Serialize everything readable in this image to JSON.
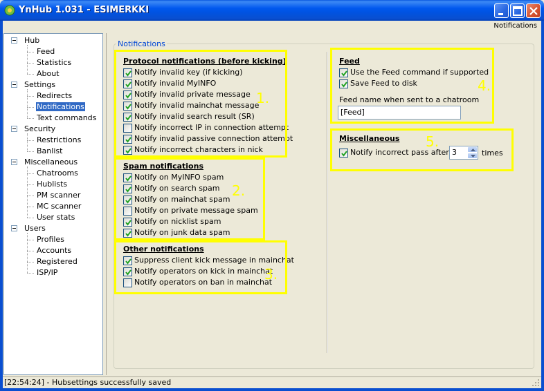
{
  "window": {
    "title": "YnHub 1.031 - ESIMERKKI",
    "page_label": "Notifications",
    "buttons": [
      "minimize",
      "maximize",
      "close"
    ]
  },
  "tree": {
    "items": [
      {
        "label": "Hub",
        "level": 0,
        "expander": true
      },
      {
        "label": "Feed",
        "level": 1
      },
      {
        "label": "Statistics",
        "level": 1
      },
      {
        "label": "About",
        "level": 1
      },
      {
        "label": "Settings",
        "level": 0,
        "expander": true
      },
      {
        "label": "Redirects",
        "level": 1
      },
      {
        "label": "Notifications",
        "level": 1,
        "selected": true
      },
      {
        "label": "Text commands",
        "level": 1
      },
      {
        "label": "Security",
        "level": 0,
        "expander": true
      },
      {
        "label": "Restrictions",
        "level": 1
      },
      {
        "label": "Banlist",
        "level": 1
      },
      {
        "label": "Miscellaneous",
        "level": 0,
        "expander": true
      },
      {
        "label": "Chatrooms",
        "level": 1
      },
      {
        "label": "Hublists",
        "level": 1
      },
      {
        "label": "PM scanner",
        "level": 1
      },
      {
        "label": "MC scanner",
        "level": 1
      },
      {
        "label": "User stats",
        "level": 1
      },
      {
        "label": "Users",
        "level": 0,
        "expander": true
      },
      {
        "label": "Profiles",
        "level": 1
      },
      {
        "label": "Accounts",
        "level": 1
      },
      {
        "label": "Registered",
        "level": 1
      },
      {
        "label": "ISP/IP",
        "level": 1
      }
    ]
  },
  "panel": {
    "legend": "Notifications",
    "protocol": {
      "title": "Protocol notifications (before kicking)",
      "marker": "1.",
      "items": [
        {
          "label": "Notify invalid key (if kicking)",
          "checked": true
        },
        {
          "label": "Notify invalid MyINFO",
          "checked": true
        },
        {
          "label": "Notify invalid private message",
          "checked": true
        },
        {
          "label": "Notify invalid mainchat message",
          "checked": true
        },
        {
          "label": "Notify invalid search result (SR)",
          "checked": true
        },
        {
          "label": "Notify incorrect IP in connection attempt",
          "checked": false
        },
        {
          "label": "Notify invalid passive connection attempt",
          "checked": true
        },
        {
          "label": "Notify incorrect characters in nick",
          "checked": true
        }
      ]
    },
    "spam": {
      "title": "Spam notifications",
      "marker": "2.",
      "items": [
        {
          "label": "Notify on MyINFO spam",
          "checked": true
        },
        {
          "label": "Notify on search spam",
          "checked": true
        },
        {
          "label": "Notify on mainchat spam",
          "checked": true
        },
        {
          "label": "Notify on private message spam",
          "checked": false
        },
        {
          "label": "Notify on nicklist spam",
          "checked": true
        },
        {
          "label": "Notify on junk data spam",
          "checked": true
        }
      ]
    },
    "other": {
      "title": "Other notifications",
      "marker": "3.",
      "items": [
        {
          "label": "Suppress client kick message in mainchat",
          "checked": true
        },
        {
          "label": "Notify operators on kick in mainchat",
          "checked": true
        },
        {
          "label": "Notify operators on ban in mainchat",
          "checked": false
        }
      ]
    },
    "feed": {
      "title": "Feed",
      "marker": "4.",
      "items": [
        {
          "label": "Use the Feed command if supported",
          "checked": true
        },
        {
          "label": "Save Feed to disk",
          "checked": true
        }
      ],
      "name_label": "Feed name when sent to a chatroom",
      "name_value": "[Feed]"
    },
    "misc": {
      "title": "Miscellaneous",
      "marker": "5.",
      "pass_label": "Notify incorrect pass after",
      "pass_checked": true,
      "pass_value": "3",
      "pass_unit": "times"
    }
  },
  "status": {
    "text": "[22:54:24] - Hubsettings successfully saved"
  },
  "colors": {
    "highlight": "#ffff00",
    "selection": "#316ac5",
    "legend": "#0046d5"
  }
}
